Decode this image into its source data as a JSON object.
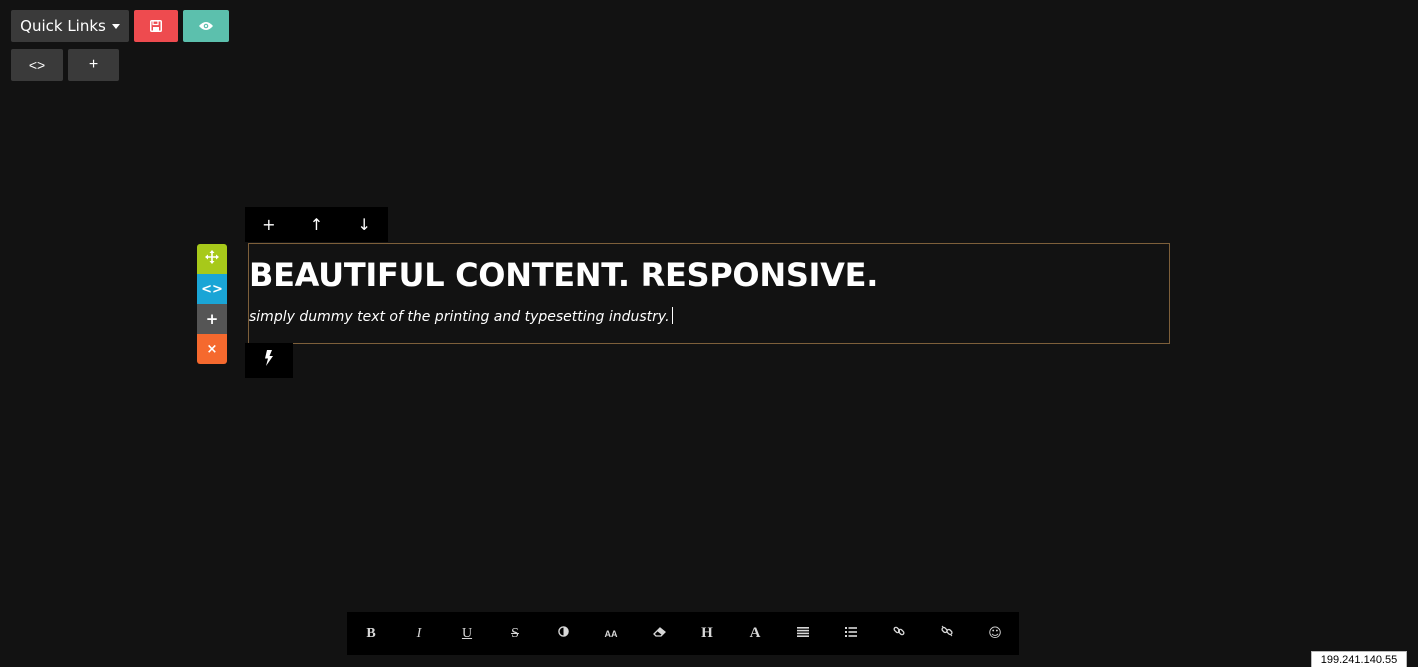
{
  "top_toolbar": {
    "quick_links_label": "Quick Links",
    "save_icon": "floppy-disk-icon",
    "preview_icon": "eye-icon",
    "code_label": "<>",
    "add_label": "+"
  },
  "row_toolbar": {
    "add_label": "+",
    "move_up_label": "↑",
    "move_down_label": "↓"
  },
  "side_toolbar": {
    "move_icon": "move-arrows-icon",
    "code_label": "<>",
    "add_label": "+",
    "remove_label": "×"
  },
  "content": {
    "headline": "BEAUTIFUL CONTENT. RESPONSIVE.",
    "subline": "simply dummy text of the printing and typesetting industry."
  },
  "action_button": {
    "icon": "lightning-bolt-icon"
  },
  "format_toolbar": {
    "bold": "B",
    "italic": "I",
    "underline": "U",
    "strikethrough": "S",
    "color_icon": "contrast-icon",
    "font_size": "AA",
    "clear_format_icon": "eraser-icon",
    "heading": "H",
    "font": "A",
    "align_icon": "align-justify-icon",
    "list_icon": "list-icon",
    "link_icon": "link-icon",
    "unlink_icon": "unlink-icon",
    "emoji": "☺"
  },
  "ip_address": "199.241.140.55",
  "colors": {
    "background": "#121212",
    "save": "#ee4b4f",
    "preview": "#5cc0ad",
    "move": "#a7c91a",
    "code": "#1aa5d6",
    "remove": "#f5692e",
    "border": "#7d5f3a"
  }
}
